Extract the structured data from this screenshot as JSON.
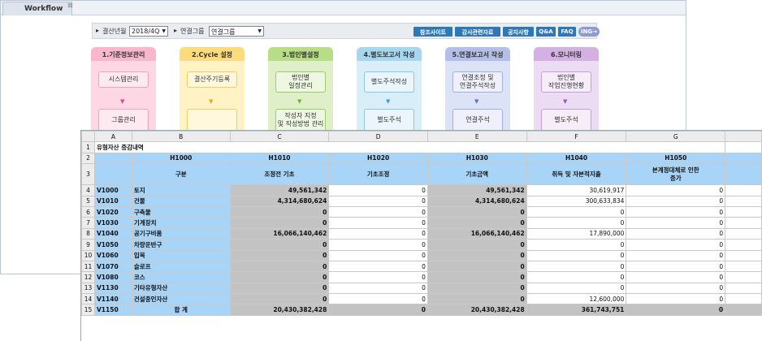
{
  "window": {
    "tab": "Workflow"
  },
  "toolbar": {
    "period_label": "결산년월",
    "period_value": "2018/4Q",
    "group_label": "연결그룹",
    "group_value": "연결그룹",
    "buttons": [
      "참조사이트",
      "감사관련자료",
      "공지사항",
      "Q&A",
      "FAQ",
      "ING→"
    ]
  },
  "stages": [
    {
      "title": "1.기준정보관리",
      "color": "#fdd7e4",
      "head": "#f9b7ce",
      "boxbg": "#fdeaf1",
      "boxbd": "#f1a3bf",
      "arrow": "#e0407f",
      "boxes": [
        "시스템관리",
        "그룹관리"
      ]
    },
    {
      "title": "2.Cycle 설정",
      "color": "#fff2c4",
      "head": "#fbdb7b",
      "boxbg": "#fff8dc",
      "boxbd": "#f1cd64",
      "arrow": "#e0ad17",
      "boxes": [
        "결산주기등록",
        ""
      ]
    },
    {
      "title": "3.법인별설정",
      "color": "#dff0c8",
      "head": "#b7dd86",
      "boxbg": "#eef7e2",
      "boxbd": "#9fcc6a",
      "arrow": "#6fb02d",
      "boxes": [
        "법인별\n일정관리",
        "작성자 지정\n및 작성방법 관리"
      ]
    },
    {
      "title": "4.별도보고서 작성",
      "color": "#d8eef8",
      "head": "#a7d6ef",
      "boxbg": "#eaf6fc",
      "boxbd": "#8cc7e7",
      "arrow": "#3c9fd3",
      "boxes": [
        "별도주석작성",
        "별도주석"
      ]
    },
    {
      "title": "5.연결보고서 작성",
      "color": "#dde3f6",
      "head": "#b3bfe8",
      "boxbg": "#eef1fb",
      "boxbd": "#a2b0e1",
      "arrow": "#5b6fc8",
      "boxes": [
        "연결조정 및\n연결주석작성",
        "연결주석"
      ]
    },
    {
      "title": "6.모니터링",
      "color": "#ecdcf3",
      "head": "#d3b2e3",
      "boxbg": "#f6edf9",
      "boxbd": "#c49ed9",
      "arrow": "#9b55bd",
      "boxes": [
        "법인별\n작업진행현황",
        "별도주석"
      ]
    }
  ],
  "sheet": {
    "columns": [
      "A",
      "B",
      "C",
      "D",
      "E",
      "F",
      "G"
    ],
    "title": "유형자산 증감내역",
    "codes": [
      "",
      "H1000",
      "H1010",
      "H1020",
      "H1030",
      "H1040",
      "H1050"
    ],
    "headers": [
      "",
      "구분",
      "조정전 기초",
      "기초조정",
      "기초금액",
      "취득 및 자본적지출",
      "본계정대체로 인한\n증가"
    ],
    "rows": [
      {
        "n": "4",
        "code": "V1000",
        "name": "토지",
        "vals": [
          "49,561,342",
          "0",
          "49,561,342",
          "30,619,917",
          "0"
        ]
      },
      {
        "n": "5",
        "code": "V1010",
        "name": "건물",
        "vals": [
          "4,314,680,624",
          "0",
          "4,314,680,624",
          "300,633,834",
          "0"
        ]
      },
      {
        "n": "6",
        "code": "V1020",
        "name": "구축물",
        "vals": [
          "0",
          "0",
          "0",
          "0",
          "0"
        ]
      },
      {
        "n": "7",
        "code": "V1030",
        "name": "기계장치",
        "vals": [
          "0",
          "0",
          "0",
          "0",
          "0"
        ]
      },
      {
        "n": "8",
        "code": "V1040",
        "name": "공기구비품",
        "vals": [
          "16,066,140,462",
          "0",
          "16,066,140,462",
          "17,890,000",
          "0"
        ]
      },
      {
        "n": "9",
        "code": "V1050",
        "name": "차량운반구",
        "vals": [
          "0",
          "0",
          "0",
          "0",
          "0"
        ]
      },
      {
        "n": "10",
        "code": "V1060",
        "name": "입목",
        "vals": [
          "0",
          "0",
          "0",
          "0",
          "0"
        ]
      },
      {
        "n": "11",
        "code": "V1070",
        "name": "슬로프",
        "vals": [
          "0",
          "0",
          "0",
          "0",
          "0"
        ]
      },
      {
        "n": "12",
        "code": "V1080",
        "name": "코스",
        "vals": [
          "0",
          "0",
          "0",
          "0",
          "0"
        ]
      },
      {
        "n": "13",
        "code": "V1130",
        "name": "기타유형자산",
        "vals": [
          "0",
          "0",
          "0",
          "0",
          "0"
        ]
      },
      {
        "n": "14",
        "code": "V1140",
        "name": "건설중인자산",
        "vals": [
          "0",
          "0",
          "0",
          "12,600,000",
          "0"
        ]
      },
      {
        "n": "15",
        "code": "V1150",
        "name": "합    계",
        "vals": [
          "20,430,382,428",
          "0",
          "20,430,382,428",
          "361,743,751",
          "0"
        ]
      }
    ]
  }
}
